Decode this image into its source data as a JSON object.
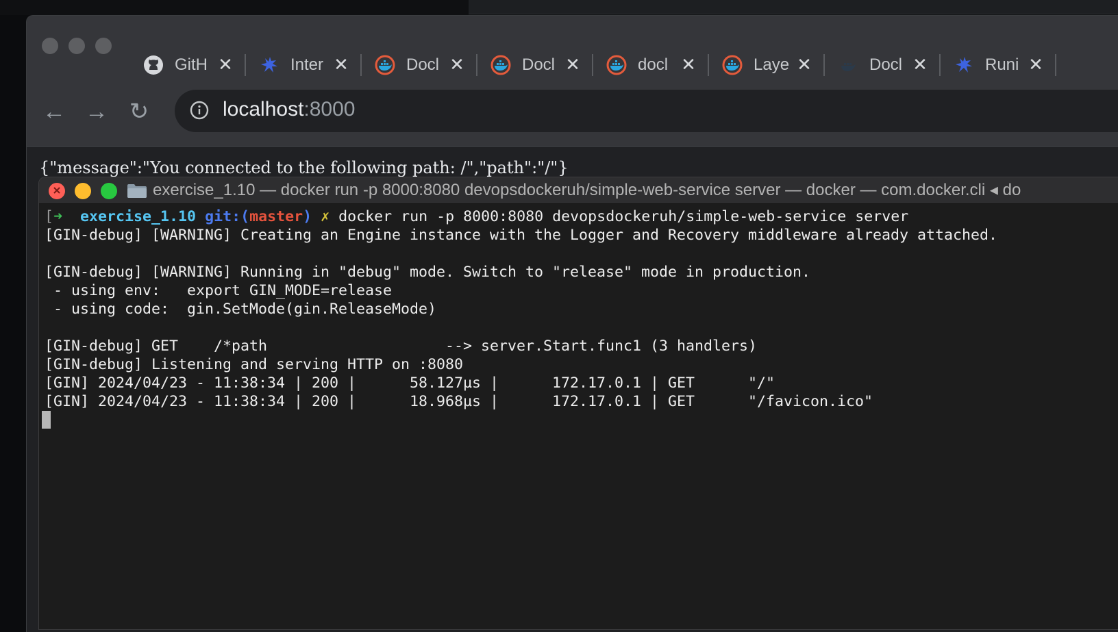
{
  "browser": {
    "tabs": [
      {
        "title": "GitH",
        "icon": "github-icon"
      },
      {
        "title": "Inter",
        "icon": "run-icon"
      },
      {
        "title": "Docl",
        "icon": "docker-icon"
      },
      {
        "title": "Docl",
        "icon": "docker-icon"
      },
      {
        "title": "docl",
        "icon": "docker-icon"
      },
      {
        "title": "Laye",
        "icon": "docker-icon"
      },
      {
        "title": "Docl",
        "icon": "docker-dim-icon"
      },
      {
        "title": "Runi",
        "icon": "run-icon"
      }
    ],
    "tab_close_glyph": "✕",
    "nav": {
      "back": "←",
      "forward": "→",
      "reload": "↻"
    },
    "url": {
      "host": "localhost",
      "port": ":8000"
    },
    "page_text": "{\"message\":\"You connected to the following path: /\",\"path\":\"/\"}"
  },
  "terminal": {
    "title": "exercise_1.10 — docker run -p 8000:8080 devopsdockeruh/simple-web-service server — docker — com.docker.cli ◂ do",
    "prompt": {
      "bracket": "[",
      "arrow": "➜",
      "dir": "exercise_1.10",
      "git_label": "git:(",
      "branch": "master",
      "git_close": ")",
      "dirty": "✗",
      "command": "docker run -p 8000:8080 devopsdockeruh/simple-web-service server"
    },
    "lines": [
      "[GIN-debug] [WARNING] Creating an Engine instance with the Logger and Recovery middleware already attached.",
      "",
      "[GIN-debug] [WARNING] Running in \"debug\" mode. Switch to \"release\" mode in production.",
      " - using env:   export GIN_MODE=release",
      " - using code:  gin.SetMode(gin.ReleaseMode)",
      "",
      "[GIN-debug] GET    /*path                    --> server.Start.func1 (3 handlers)",
      "[GIN-debug] Listening and serving HTTP on :8080",
      "[GIN] 2024/04/23 - 11:38:34 | 200 |      58.127µs |      172.17.0.1 | GET      \"/\"",
      "[GIN] 2024/04/23 - 11:38:34 | 200 |      18.968µs |      172.17.0.1 | GET      \"/favicon.ico\""
    ]
  },
  "colors": {
    "prompt_arrow": "#3fbf57",
    "prompt_dir": "#56c6f2",
    "prompt_branch": "#e5533d",
    "traffic_red": "#ff5f57",
    "traffic_yellow": "#febc2e",
    "traffic_green": "#28c840"
  }
}
